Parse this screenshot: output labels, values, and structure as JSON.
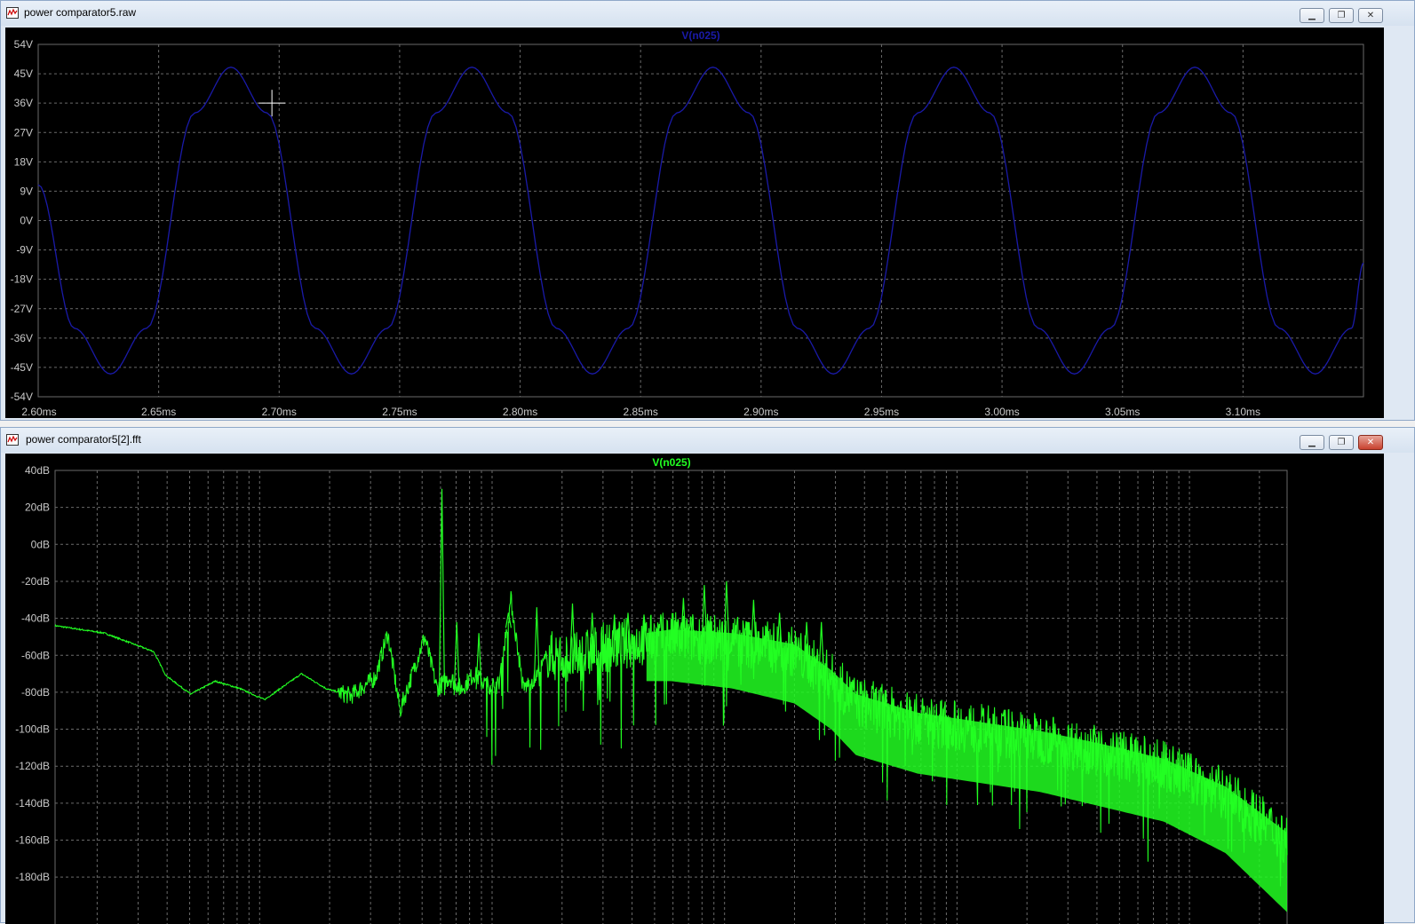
{
  "colors": {
    "trace_top": "#1a1aa8",
    "trace_bottom": "#22ff22",
    "grid": "#6a6a6a",
    "axis_text": "#c8c8c8",
    "background": "#000000"
  },
  "icons": {
    "window_icon": "plot-window-icon",
    "minimize": "minimize-icon",
    "restore": "restore-icon",
    "close": "close-icon"
  },
  "window_top": {
    "title": "power comparator5.raw",
    "minimize_glyph": "▁",
    "restore_glyph": "❐",
    "close_glyph": "✕",
    "chart_data": {
      "type": "line",
      "title": "V(n025)",
      "xlabel": "",
      "ylabel": "",
      "xlim": [
        2.6,
        3.15
      ],
      "ylim": [
        -54,
        54
      ],
      "x_unit": "ms",
      "y_unit": "V",
      "x_ticks": [
        "2.60ms",
        "2.65ms",
        "2.70ms",
        "2.75ms",
        "2.80ms",
        "2.85ms",
        "2.90ms",
        "2.95ms",
        "3.00ms",
        "3.05ms",
        "3.10ms"
      ],
      "y_ticks": [
        "54V",
        "45V",
        "36V",
        "27V",
        "18V",
        "9V",
        "0V",
        "-9V",
        "-18V",
        "-27V",
        "-36V",
        "-45V",
        "-54V"
      ],
      "series": [
        {
          "name": "V(n025)",
          "x": [
            2.6,
            2.615,
            2.63,
            2.645,
            2.665,
            2.68,
            2.695,
            2.715,
            2.73,
            2.745,
            2.765,
            2.78,
            2.795,
            2.815,
            2.83,
            2.845,
            2.865,
            2.88,
            2.895,
            2.915,
            2.93,
            2.945,
            2.965,
            2.98,
            2.995,
            3.015,
            3.03,
            3.045,
            3.065,
            3.08,
            3.095,
            3.115,
            3.13,
            3.145,
            3.15
          ],
          "y": [
            11,
            -33,
            -47,
            -33,
            33,
            47,
            33,
            -33,
            -47,
            -33,
            33,
            47,
            33,
            -33,
            -47,
            -33,
            33,
            47,
            33,
            -33,
            -47,
            -33,
            33,
            47,
            33,
            -33,
            -47,
            -33,
            33,
            47,
            33,
            -33,
            -47,
            -33,
            -13
          ]
        }
      ],
      "grid": true,
      "cursor": {
        "x": 2.697,
        "y": 36
      }
    }
  },
  "window_bottom": {
    "title": "power comparator5[2].fft",
    "minimize_glyph": "▁",
    "restore_glyph": "❐",
    "close_glyph": "✕",
    "chart_data": {
      "type": "line",
      "title": "V(n025)",
      "xlabel": "",
      "ylabel": "",
      "x_scale": "log",
      "ylim": [
        -200,
        40
      ],
      "y_unit": "dB",
      "y_ticks": [
        "40dB",
        "20dB",
        "0dB",
        "-20dB",
        "-40dB",
        "-60dB",
        "-80dB",
        "-100dB",
        "-120dB",
        "-140dB",
        "-160dB",
        "-180dB"
      ],
      "series": [
        {
          "name": "V(n025)",
          "envelope_x_frac": [
            0.0,
            0.04,
            0.08,
            0.09,
            0.11,
            0.13,
            0.15,
            0.17,
            0.2,
            0.22,
            0.24,
            0.26,
            0.27,
            0.28,
            0.3,
            0.31,
            0.32,
            0.33,
            0.34,
            0.35,
            0.36,
            0.37,
            0.38,
            0.39,
            0.4,
            0.42,
            0.45,
            0.5,
            0.55,
            0.6,
            0.63,
            0.65,
            0.7,
            0.75,
            0.8,
            0.85,
            0.9,
            0.95,
            1.0
          ],
          "envelope_y_db": [
            -44,
            -48,
            -58,
            -71,
            -81,
            -74,
            -78,
            -84,
            -70,
            -78,
            -82,
            -72,
            -48,
            -90,
            -50,
            -78,
            -72,
            -78,
            -70,
            -76,
            -76,
            -30,
            -78,
            -72,
            -60,
            -62,
            -55,
            -50,
            -52,
            -58,
            -72,
            -85,
            -95,
            -100,
            -105,
            -112,
            -120,
            -135,
            -160
          ],
          "band_low_offset_db": [
            0,
            0,
            0,
            0,
            0,
            0,
            0,
            0,
            0,
            0,
            0,
            0,
            0,
            0,
            0,
            0,
            0,
            0,
            0,
            0,
            0,
            0,
            0,
            0,
            -8,
            -12,
            -15,
            -20,
            -22,
            -24,
            -24,
            -25,
            -25,
            -25,
            -25,
            -26,
            -26,
            -28,
            -35
          ],
          "peak_frac": [
            0.314,
            0.326,
            0.344,
            0.368,
            0.391,
            0.42,
            0.436,
            0.454,
            0.465,
            0.478,
            0.51,
            0.527,
            0.545,
            0.567,
            0.588,
            0.61,
            0.622
          ],
          "peak_db": [
            30,
            -42,
            -48,
            -37,
            -34,
            -32,
            -37,
            -38,
            -37,
            -38,
            -29,
            -22,
            -20,
            -30,
            -37,
            -42,
            -42
          ]
        }
      ],
      "grid": true
    }
  }
}
